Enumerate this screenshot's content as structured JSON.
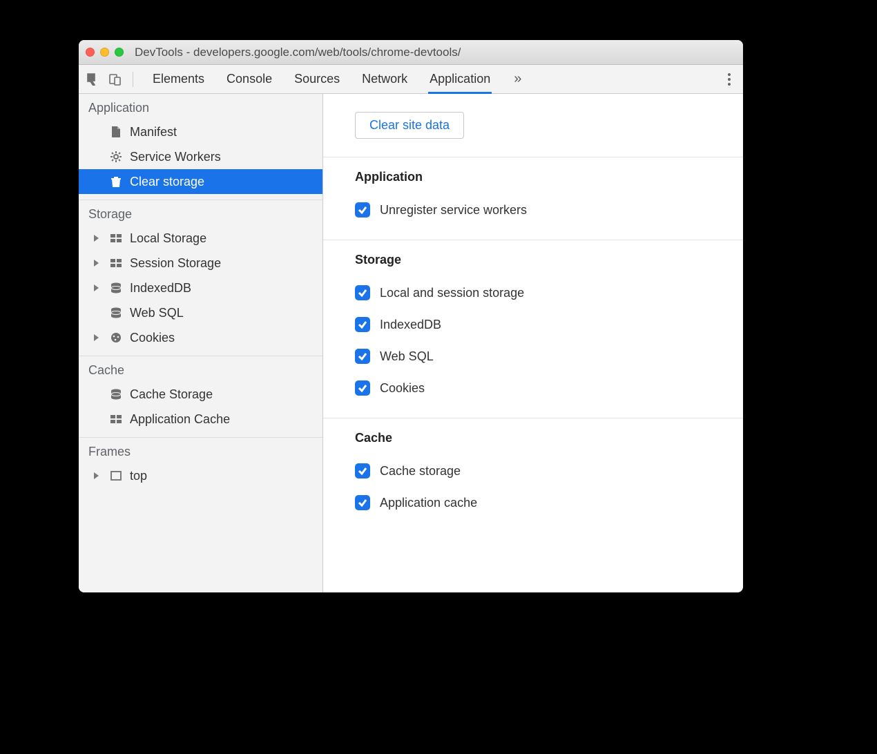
{
  "window": {
    "title": "DevTools - developers.google.com/web/tools/chrome-devtools/"
  },
  "tabs": {
    "items": [
      "Elements",
      "Console",
      "Sources",
      "Network",
      "Application"
    ],
    "active": "Application"
  },
  "sidebar": {
    "groups": [
      {
        "title": "Application",
        "items": [
          {
            "label": "Manifest",
            "icon": "file",
            "expandable": false,
            "selected": false
          },
          {
            "label": "Service Workers",
            "icon": "gear",
            "expandable": false,
            "selected": false
          },
          {
            "label": "Clear storage",
            "icon": "trash",
            "expandable": false,
            "selected": true
          }
        ]
      },
      {
        "title": "Storage",
        "items": [
          {
            "label": "Local Storage",
            "icon": "grid",
            "expandable": true,
            "selected": false
          },
          {
            "label": "Session Storage",
            "icon": "grid",
            "expandable": true,
            "selected": false
          },
          {
            "label": "IndexedDB",
            "icon": "db",
            "expandable": true,
            "selected": false
          },
          {
            "label": "Web SQL",
            "icon": "db",
            "expandable": false,
            "selected": false
          },
          {
            "label": "Cookies",
            "icon": "cookie",
            "expandable": true,
            "selected": false
          }
        ]
      },
      {
        "title": "Cache",
        "items": [
          {
            "label": "Cache Storage",
            "icon": "db",
            "expandable": false,
            "selected": false
          },
          {
            "label": "Application Cache",
            "icon": "grid",
            "expandable": false,
            "selected": false
          }
        ]
      },
      {
        "title": "Frames",
        "items": [
          {
            "label": "top",
            "icon": "frame",
            "expandable": true,
            "selected": false
          }
        ]
      }
    ]
  },
  "content": {
    "clear_button": "Clear site data",
    "sections": [
      {
        "title": "Application",
        "checks": [
          {
            "label": "Unregister service workers",
            "checked": true
          }
        ]
      },
      {
        "title": "Storage",
        "checks": [
          {
            "label": "Local and session storage",
            "checked": true
          },
          {
            "label": "IndexedDB",
            "checked": true
          },
          {
            "label": "Web SQL",
            "checked": true
          },
          {
            "label": "Cookies",
            "checked": true
          }
        ]
      },
      {
        "title": "Cache",
        "checks": [
          {
            "label": "Cache storage",
            "checked": true
          },
          {
            "label": "Application cache",
            "checked": true
          }
        ]
      }
    ]
  },
  "icons": {
    "file": "file-icon",
    "gear": "gear-icon",
    "trash": "trash-icon",
    "grid": "table-icon",
    "db": "database-icon",
    "cookie": "cookie-icon",
    "frame": "frame-icon"
  }
}
